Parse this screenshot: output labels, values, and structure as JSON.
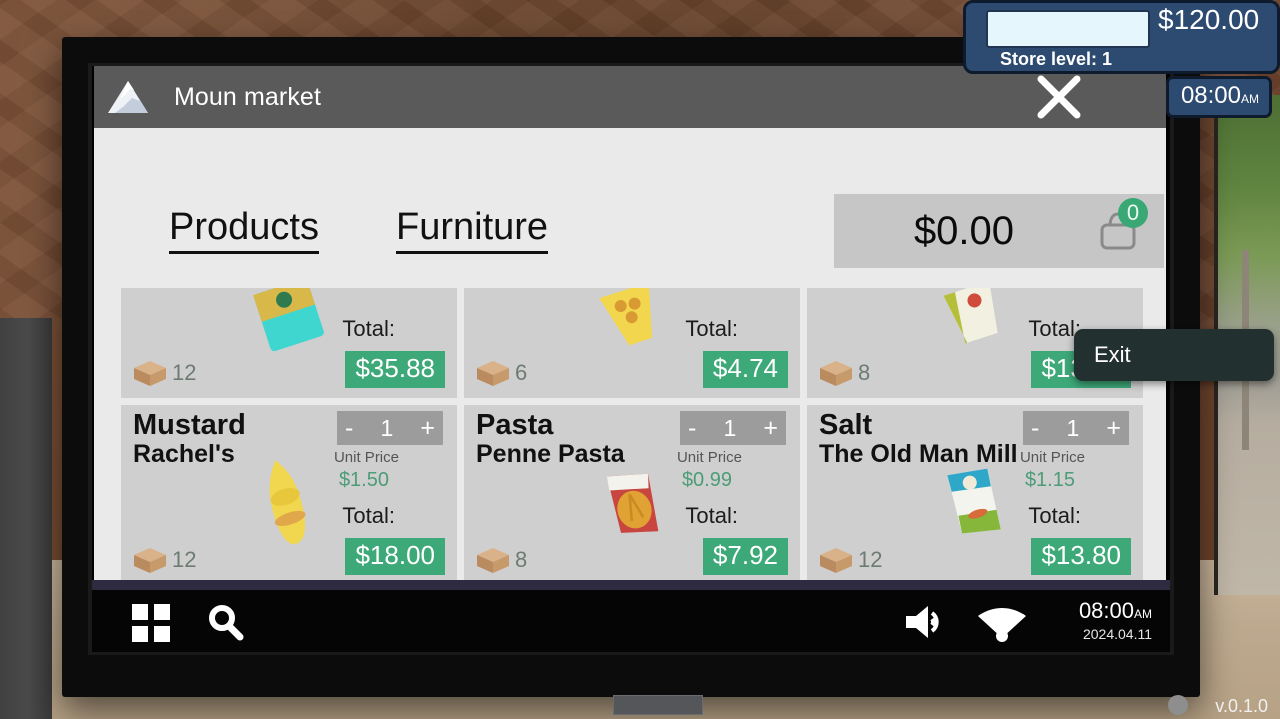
{
  "hud": {
    "money": "$120.00",
    "store_level": "Store level: 1",
    "clock_time": "08:00",
    "clock_ampm": "AM"
  },
  "version": "v.0.1.0",
  "app": {
    "title": "Moun market",
    "logo_icon": "mountain-icon",
    "close_icon": "close-icon",
    "tabs": [
      {
        "label": "Products",
        "name": "tab-products"
      },
      {
        "label": "Furniture",
        "name": "tab-furniture"
      }
    ],
    "cart": {
      "total": "$0.00",
      "badge_count": "0",
      "icon": "shopping-bag-icon"
    },
    "labels": {
      "unit_price": "Unit Price",
      "total": "Total:",
      "minus": "-",
      "plus": "+"
    },
    "partial_row": [
      {
        "stock": "12",
        "total": "$35.88"
      },
      {
        "stock": "6",
        "total": "$4.74"
      },
      {
        "stock": "8",
        "total": "$13.80"
      }
    ],
    "products": [
      {
        "name": "Mustard",
        "brand": "Rachel's",
        "qty": "1",
        "unit_price": "$1.50",
        "stock": "12",
        "total": "$18.00"
      },
      {
        "name": "Pasta",
        "brand": "Penne Pasta",
        "qty": "1",
        "unit_price": "$0.99",
        "stock": "8",
        "total": "$7.92"
      },
      {
        "name": "Salt",
        "brand": "The Old Man Mill",
        "qty": "1",
        "unit_price": "$1.15",
        "stock": "12",
        "total": "$13.80"
      }
    ]
  },
  "exit_button": {
    "label": "Exit"
  },
  "taskbar": {
    "start_icon": "windows-grid-icon",
    "search_icon": "search-icon",
    "volume_icon": "volume-icon",
    "wifi_icon": "wifi-icon",
    "time": "08:00",
    "ampm": "AM",
    "date": "2024.04.11"
  },
  "colors": {
    "accent_green": "#3da878",
    "hud_blue": "#2d4a70",
    "titlebar_gray": "#5a5a5a",
    "card_gray": "#cfcfcf"
  }
}
